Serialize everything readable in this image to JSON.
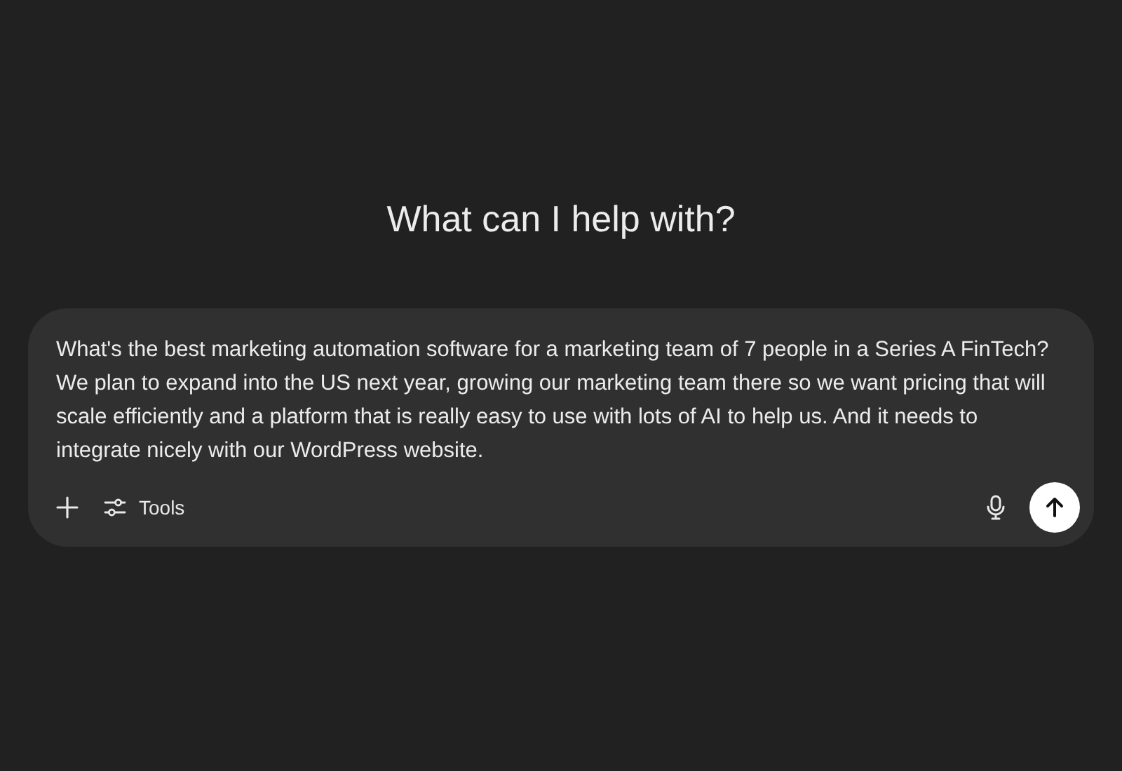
{
  "heading": "What can I help with?",
  "composer": {
    "value": "What's the best marketing automation software for a marketing team of 7 people in a Series A FinTech? We plan to expand into the US next year, growing our marketing team there so we want pricing that will scale efficiently and a platform that is really easy to use with lots of AI to help us. And it needs to integrate nicely with our WordPress website.",
    "tools_label": "Tools"
  }
}
